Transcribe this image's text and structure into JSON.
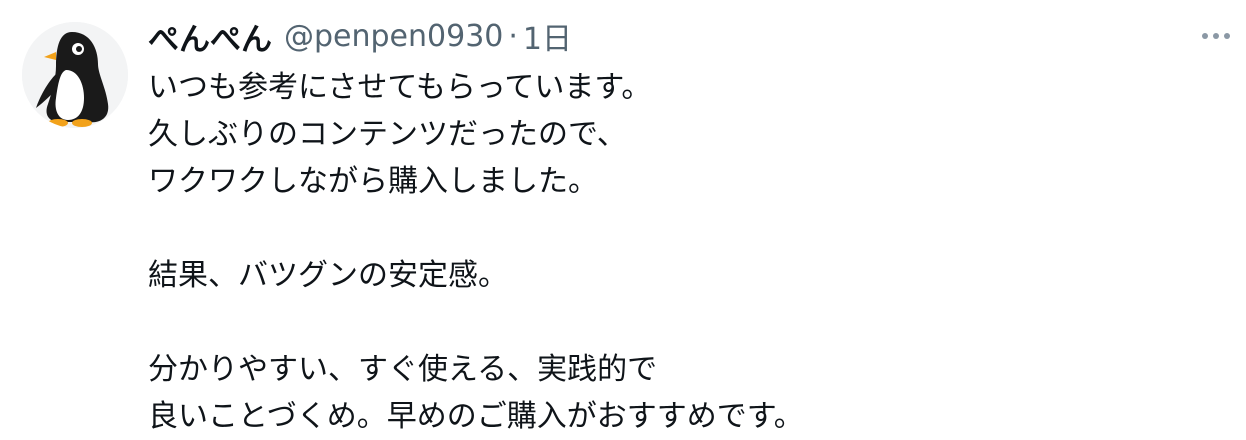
{
  "tweet": {
    "display_name": "ぺんぺん",
    "handle": "@penpen0930",
    "separator": "·",
    "timestamp": "1日",
    "more_icon": "more-horizontal-icon",
    "avatar_icon": "penguin-avatar",
    "text_lines": [
      "いつも参考にさせてもらっています。",
      "久しぶりのコンテンツだったので、",
      "ワクワクしながら購入しました。",
      "",
      "結果、バツグンの安定感。",
      "",
      "分かりやすい、すぐ使える、実践的で",
      "良いことづくめ。早めのご購入がおすすめです。"
    ]
  },
  "colors": {
    "text_primary": "#0f1419",
    "text_secondary": "#536471",
    "background": "#ffffff"
  }
}
